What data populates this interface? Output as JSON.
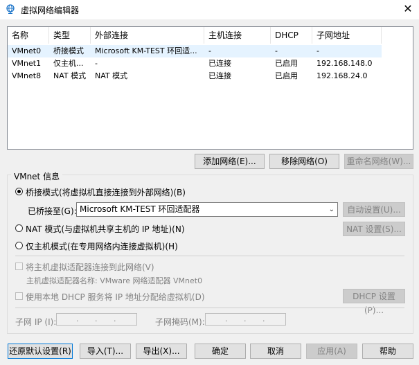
{
  "window": {
    "title": "虚拟网络编辑器",
    "close": "✕"
  },
  "table": {
    "columns": [
      "名称",
      "类型",
      "外部连接",
      "主机连接",
      "DHCP",
      "子网地址"
    ],
    "rows": [
      {
        "name": "VMnet0",
        "type": "桥接模式",
        "external": "Microsoft KM-TEST 环回适...",
        "host": "-",
        "dhcp": "-",
        "subnet": "-"
      },
      {
        "name": "VMnet1",
        "type": "仅主机...",
        "external": "-",
        "host": "已连接",
        "dhcp": "已启用",
        "subnet": "192.168.148.0"
      },
      {
        "name": "VMnet8",
        "type": "NAT 模式",
        "external": "NAT 模式",
        "host": "已连接",
        "dhcp": "已启用",
        "subnet": "192.168.24.0"
      }
    ]
  },
  "network_buttons": {
    "add": "添加网络(E)...",
    "remove": "移除网络(O)",
    "rename": "重命名网络(W)..."
  },
  "vmnet_info": {
    "group_label": "VMnet 信息",
    "bridge_option": "桥接模式(将虚拟机直接连接到外部网络)(B)",
    "bridged_to_label": "已桥接至(G):",
    "bridged_to_value": "Microsoft KM-TEST 环回适配器",
    "auto_settings": "自动设置(U)...",
    "nat_option": "NAT 模式(与虚拟机共享主机的 IP 地址)(N)",
    "nat_settings": "NAT 设置(S)...",
    "hostonly_option": "仅主机模式(在专用网络内连接虚拟机)(H)",
    "connect_adapter": "将主机虚拟适配器连接到此网络(V)",
    "adapter_name": "主机虚拟适配器名称: VMware 网络适配器 VMnet0",
    "use_dhcp": "使用本地 DHCP 服务将 IP 地址分配给虚拟机(D)",
    "dhcp_settings": "DHCP 设置(P)...",
    "subnet_ip_label": "子网 IP (I):",
    "subnet_mask_label": "子网掩码(M):",
    "ip_dot": "."
  },
  "footer": {
    "restore": "还原默认设置(R)",
    "import": "导入(T)...",
    "export": "导出(X)...",
    "ok": "确定",
    "cancel": "取消",
    "apply": "应用(A)",
    "help": "帮助"
  }
}
